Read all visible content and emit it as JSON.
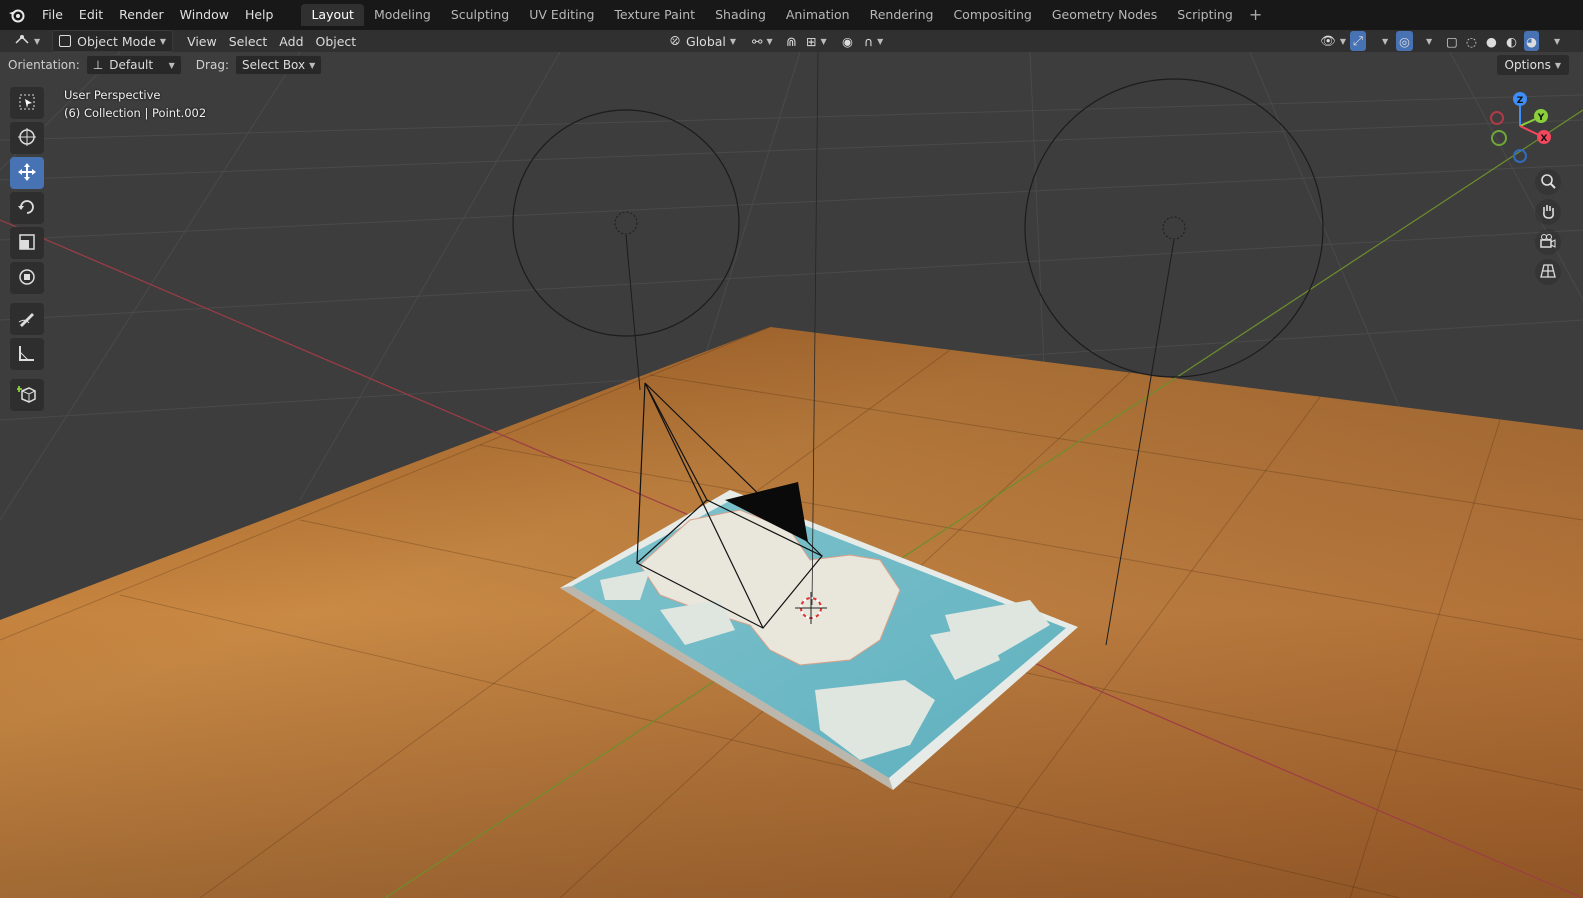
{
  "menu": {
    "items": [
      "File",
      "Edit",
      "Render",
      "Window",
      "Help"
    ]
  },
  "workspaces": {
    "tabs": [
      "Layout",
      "Modeling",
      "Sculpting",
      "UV Editing",
      "Texture Paint",
      "Shading",
      "Animation",
      "Rendering",
      "Compositing",
      "Geometry Nodes",
      "Scripting"
    ],
    "active": "Layout",
    "add": "+"
  },
  "header": {
    "mode": "Object Mode",
    "view": "View",
    "select": "Select",
    "add": "Add",
    "object": "Object",
    "transform_orientation": "Global"
  },
  "toolsettings": {
    "orientation_label": "Orientation:",
    "orientation_value": "Default",
    "drag_label": "Drag:",
    "drag_value": "Select Box",
    "options": "Options"
  },
  "viewport": {
    "perspective": "User Perspective",
    "collection": "(6) Collection | Point.002"
  },
  "gizmo": {
    "x": "X",
    "y": "Y",
    "z": "Z"
  },
  "colors": {
    "accent": "#4772b3",
    "x_axis": "#f3475d",
    "y_axis": "#8bd03b",
    "z_axis": "#3f8df6"
  },
  "tools": [
    "select-box-icon",
    "cursor-icon",
    "move-icon",
    "rotate-icon",
    "scale-icon",
    "transform-icon",
    "annotate-icon",
    "measure-icon",
    "add-cube-icon"
  ]
}
